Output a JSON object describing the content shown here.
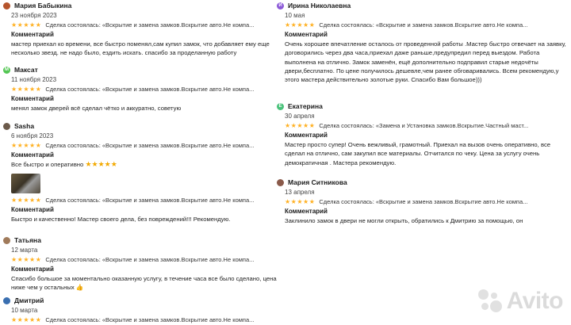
{
  "labels": {
    "comment": "Комментарий",
    "stars": "★★★★★"
  },
  "left": [
    {
      "name": "Мария Бабыкина",
      "avatar_letter": "",
      "date": "23 ноября 2023",
      "deal": "Сделка состоялась: «Вскрытие и замена замков.Вскрытие авто.Не компа...",
      "comment": "мастер приехал ко времени, все быстро поменял,сам купил замок, что добавляет ему еще несколько звезд. не надо было, ездить искать. спасибо за проделанную работу"
    },
    {
      "name": "Максат",
      "avatar_letter": "М",
      "date": "11 ноября 2023",
      "deal": "Сделка состоялась: «Вскрытие и замена замков.Вскрытие авто.Не компа...",
      "comment": "менял замок дверей всё сделал чётко и аккуратно, советую"
    },
    {
      "name": "Sasha",
      "avatar_letter": "",
      "date": "6 ноября 2023",
      "deal": "Сделка состоялась: «Вскрытие и замена замков.Вскрытие авто.Не компа...",
      "comment": "Все быстро и оперативно",
      "comment_stars": "★★★★★"
    },
    {
      "name": "",
      "date": "",
      "deal": "Сделка состоялась: «Вскрытие и замена замков.Вскрытие авто.Не компа...",
      "comment": "Быстро и качественно! Мастер своего дела, без повреждений!!! Рекомендую."
    },
    {
      "name": "Татьяна",
      "avatar_letter": "",
      "date": "12 марта",
      "deal": "Сделка состоялась: «Вскрытие и замена замков.Вскрытие авто.Не компа...",
      "comment": "Спасибо большое за моментально оказанную услугу, в течение часа все было сделано, цена ниже чем у остальных 👍"
    },
    {
      "name": "Дмитрий",
      "avatar_letter": "",
      "date": "10 марта",
      "deal": "Сделка состоялась: «Вскрытие и замена замков.Вскрытие авто.Не компа..."
    }
  ],
  "right": [
    {
      "name": "Ирина Николаевна",
      "avatar_letter": "И",
      "date": "10 мая",
      "deal": "Сделка состоялась: «Вскрытие и замена замков.Вскрытие авто.Не компа...",
      "comment": "Очень хорошее впечатление осталось от проведенной работы .Мастер быстро отвечает на заявку, договорились через два часа,приехал даже раньше,предупредил перед выездом. Работа выполнена на отлично. Замок заменён, ещё дополнительно подправил старые недочёты двери,бесплатно. По цене получилось дешевле,чем ранее обговаривались. Всем рекомендую,у этого мастера действительно золотые руки. Спасибо Вам большое)))"
    },
    {
      "name": "Екатерина",
      "avatar_letter": "Е",
      "date": "30 апреля",
      "deal": "Сделка состоялась: «Замена и Установка замков.Вскрытие.Частный маст...",
      "comment": "Мастер просто супер! Очень вежливый, грамотный. Приехал на вызов очень оперативно, все сделал на отлично, сам закупил все материалы. Отчитался по чеку. Цена за услугу очень демократичная . Мастера рекомендую."
    },
    {
      "name": "Мария Ситникова",
      "avatar_letter": "",
      "date": "13 апреля",
      "deal": "Сделка состоялась: «Вскрытие и замена замков.Вскрытие авто.Не компа...",
      "comment": "Заклинило замок в двери не могли открыть, обратились к Дмитрию за помощью, он"
    }
  ],
  "watermark": {
    "text": "Avito"
  },
  "colors": {
    "star": "#ffb021",
    "avatar_green": "#53c653",
    "avatar_purple": "#8c5ad8",
    "avatar_green2": "#49c27a"
  }
}
